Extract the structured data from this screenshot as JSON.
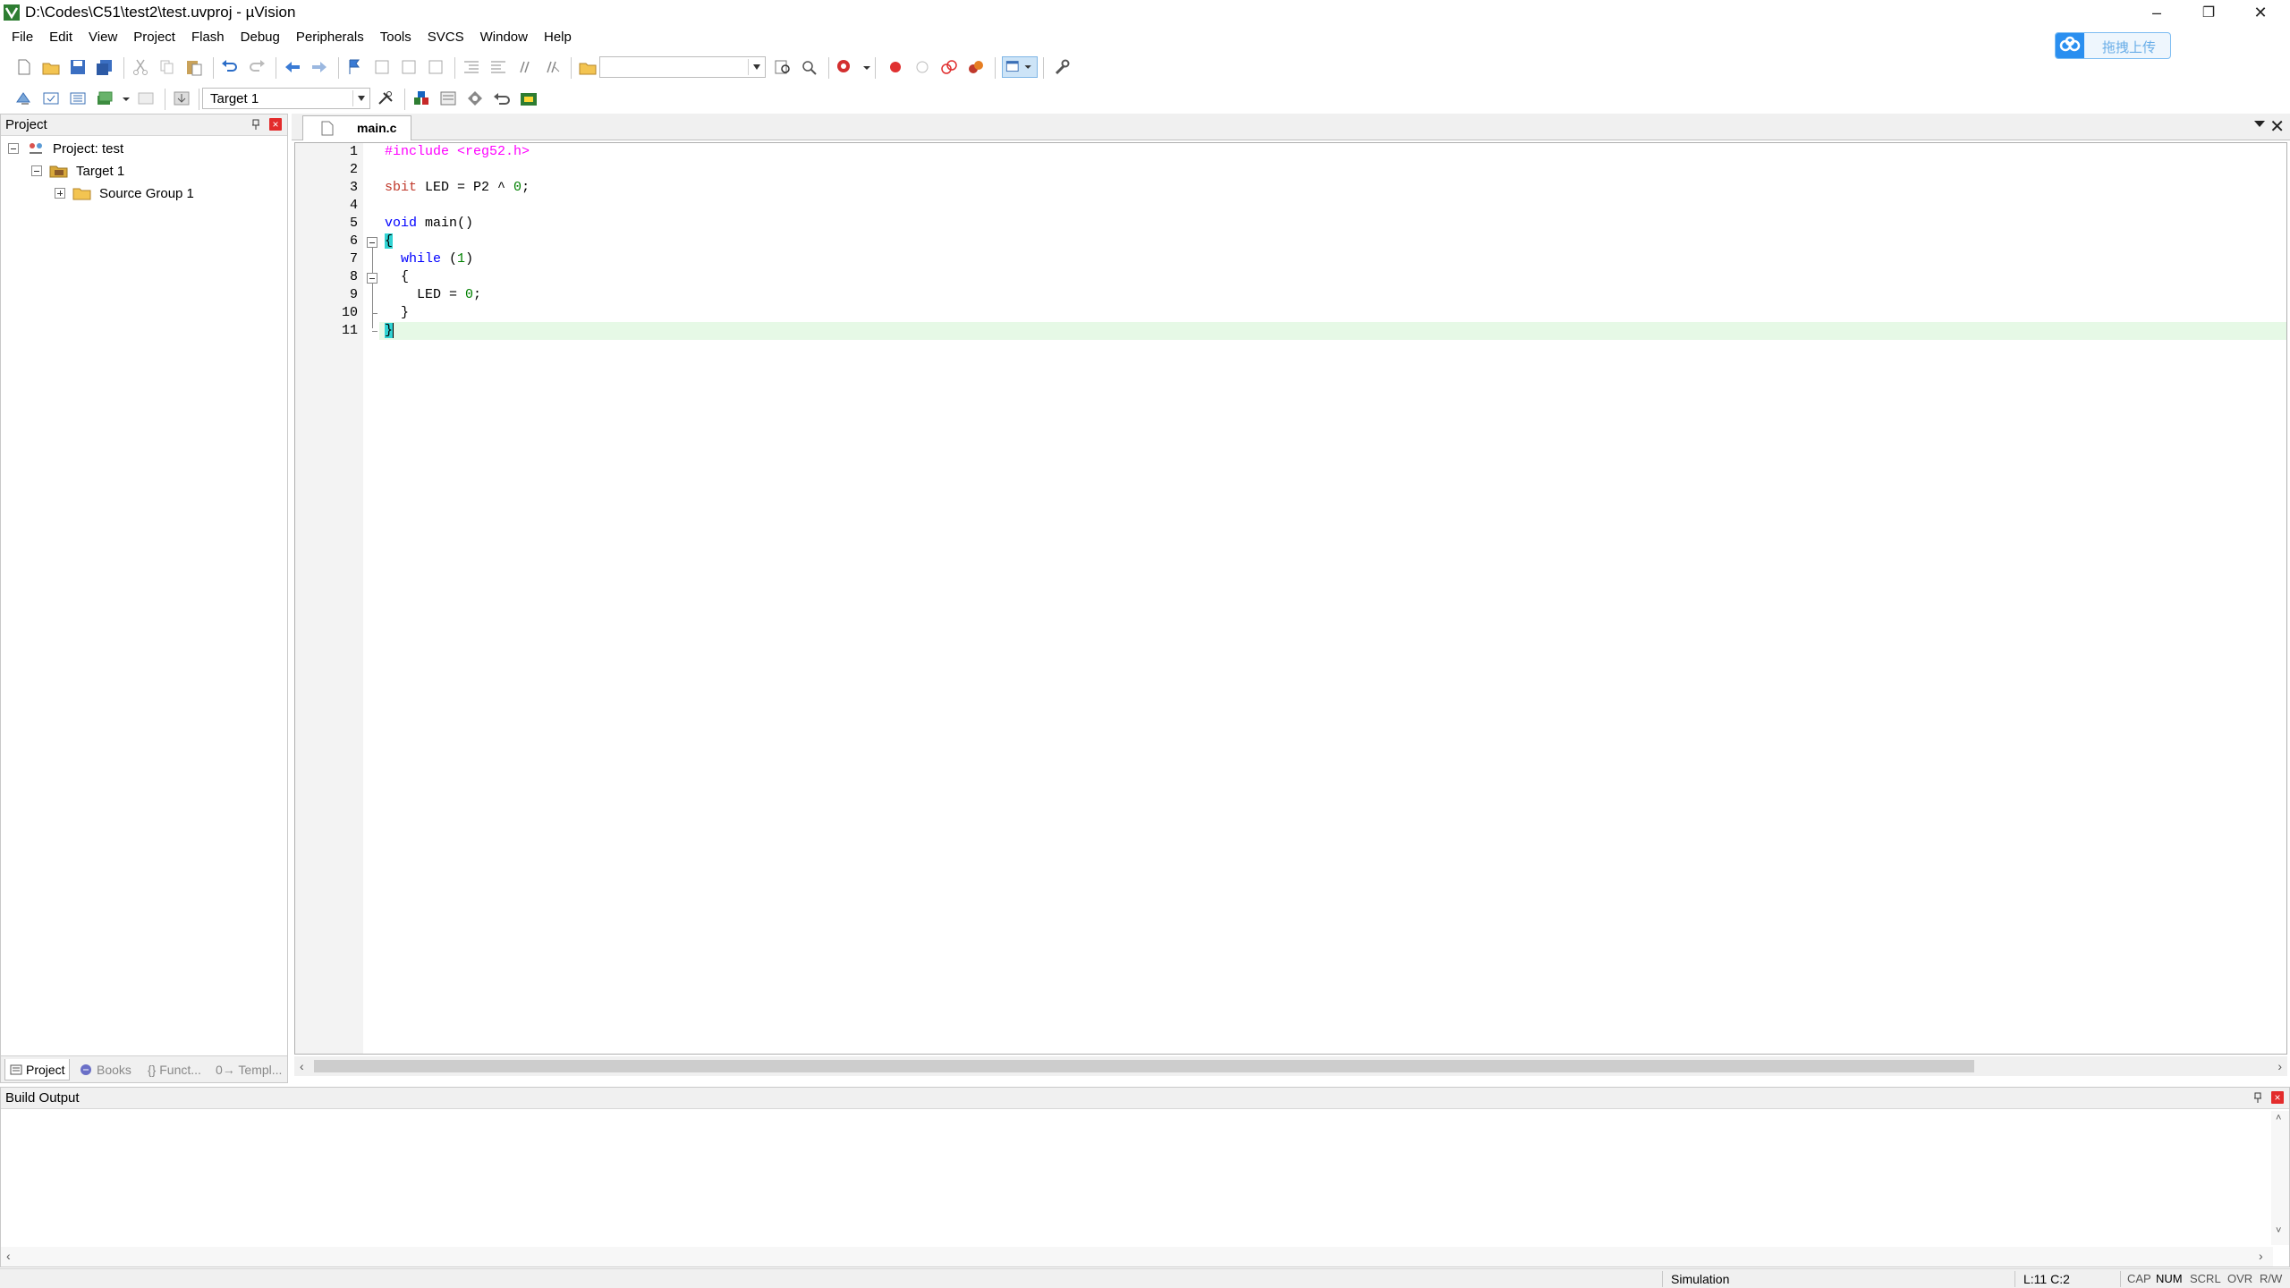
{
  "window": {
    "title": "D:\\Codes\\C51\\test2\\test.uvproj - µVision",
    "minimize_glyph": "–",
    "restore_glyph": "❐",
    "close_glyph": "✕"
  },
  "cloud_upload": {
    "label": "拖拽上传",
    "icon": "baidu-cloud-icon"
  },
  "menu": [
    "File",
    "Edit",
    "View",
    "Project",
    "Flash",
    "Debug",
    "Peripherals",
    "Tools",
    "SVCS",
    "Window",
    "Help"
  ],
  "toolbar2": {
    "target_select": "Target 1"
  },
  "project_panel": {
    "title": "Project",
    "tree": [
      {
        "label": "Project: test",
        "icon": "project-icon"
      },
      {
        "label": "Target 1",
        "icon": "target-folder-icon"
      },
      {
        "label": "Source Group 1",
        "icon": "folder-icon"
      }
    ],
    "tabs": [
      {
        "label": "Project",
        "icon": "project-tab-icon"
      },
      {
        "label": "Books",
        "icon": "books-icon"
      },
      {
        "label": "{} Funct...",
        "icon": "functions-icon"
      },
      {
        "label": "0→ Templ...",
        "icon": "templates-icon"
      }
    ]
  },
  "editor": {
    "active_tab": "main.c",
    "line_numbers": [
      "1",
      "2",
      "3",
      "4",
      "5",
      "6",
      "7",
      "8",
      "9",
      "10",
      "11"
    ],
    "code": [
      {
        "parts": [
          {
            "t": "#include ",
            "c": "pp-dir"
          },
          {
            "t": "<reg52.h>",
            "c": "pp"
          }
        ]
      },
      {
        "parts": []
      },
      {
        "parts": [
          {
            "t": "sbit",
            "c": "pink"
          },
          {
            "t": " LED = P2 ^ ",
            "c": "plain"
          },
          {
            "t": "0",
            "c": "num"
          },
          {
            "t": ";",
            "c": "plain"
          }
        ]
      },
      {
        "parts": []
      },
      {
        "parts": [
          {
            "t": "void",
            "c": "kw"
          },
          {
            "t": " main()",
            "c": "plain"
          }
        ]
      },
      {
        "parts": [
          {
            "t": "{",
            "c": "brace"
          }
        ]
      },
      {
        "parts": [
          {
            "t": "  ",
            "c": "plain"
          },
          {
            "t": "while",
            "c": "kw"
          },
          {
            "t": " (",
            "c": "plain"
          },
          {
            "t": "1",
            "c": "num"
          },
          {
            "t": ")",
            "c": "plain"
          }
        ]
      },
      {
        "parts": [
          {
            "t": "  {",
            "c": "plain"
          }
        ]
      },
      {
        "parts": [
          {
            "t": "    LED = ",
            "c": "plain"
          },
          {
            "t": "0",
            "c": "num"
          },
          {
            "t": ";",
            "c": "plain"
          }
        ]
      },
      {
        "parts": [
          {
            "t": "  }",
            "c": "plain"
          }
        ]
      },
      {
        "parts": [
          {
            "t": "}",
            "c": "brace"
          }
        ]
      }
    ],
    "colors": {
      "keyword": "#0000ff",
      "preprocessor": "#ff00ff",
      "number": "#008000",
      "current_line": "#e6f9e6",
      "brace_match": "#30d3d3"
    }
  },
  "build_output": {
    "title": "Build Output"
  },
  "status": {
    "mode": "Simulation",
    "cursor": "L:11 C:2",
    "indicators": [
      "CAP",
      "NUM",
      "SCRL",
      "OVR",
      "R/W"
    ]
  }
}
